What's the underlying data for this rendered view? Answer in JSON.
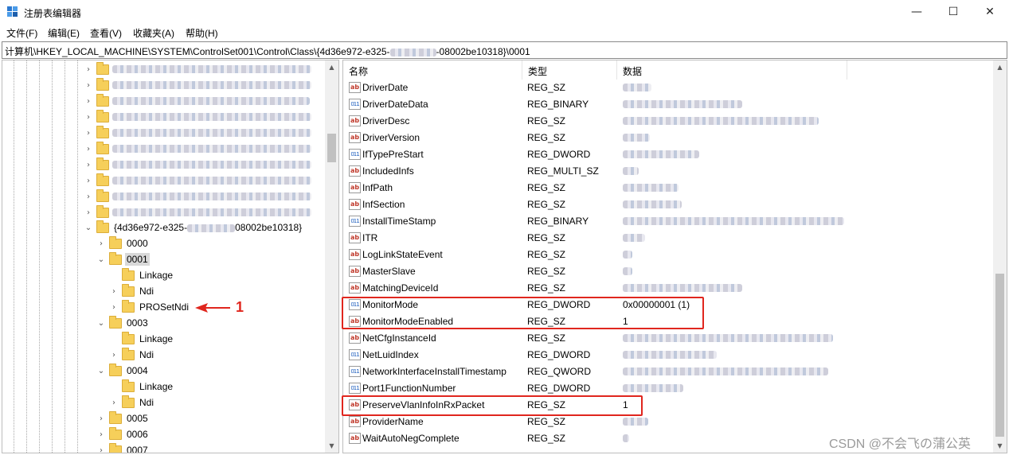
{
  "window": {
    "title": "注册表编辑器",
    "minimize_glyph": "—",
    "maximize_glyph": "☐",
    "close_glyph": "✕"
  },
  "menu": [
    "文件(F)",
    "编辑(E)",
    "查看(V)",
    "收藏夹(A)",
    "帮助(H)"
  ],
  "address": {
    "path_prefix": "计算机\\HKEY_LOCAL_MACHINE\\SYSTEM\\ControlSet001\\Control\\Class\\{4d36e972-e325-",
    "path_suffix": "-08002be10318}\\0001"
  },
  "tree": {
    "parent_key_prefix": "{4d36e972-e325-",
    "parent_key_suffix": "08002be10318}",
    "children": [
      {
        "label": "0000",
        "expanded": false
      },
      {
        "label": "0001",
        "expanded": true,
        "selected": true,
        "children": [
          "Linkage",
          "Ndi",
          "PROSetNdi"
        ]
      },
      {
        "label": "0003",
        "expanded": true,
        "children": [
          "Linkage",
          "Ndi"
        ]
      },
      {
        "label": "0004",
        "expanded": true,
        "children": [
          "Linkage",
          "Ndi"
        ]
      },
      {
        "label": "0005",
        "expanded": false
      },
      {
        "label": "0006",
        "expanded": false
      },
      {
        "label": "0007",
        "expanded": false
      }
    ]
  },
  "annotation": {
    "number": "1",
    "color": "#e0261e"
  },
  "columns": {
    "name": "名称",
    "type": "类型",
    "data": "数据"
  },
  "values": [
    {
      "name": "DriverDate",
      "icon": "string-value-icon",
      "type": "REG_SZ",
      "data": ""
    },
    {
      "name": "DriverDateData",
      "icon": "binary-value-icon",
      "type": "REG_BINARY",
      "data": ""
    },
    {
      "name": "DriverDesc",
      "icon": "string-value-icon",
      "type": "REG_SZ",
      "data": ""
    },
    {
      "name": "DriverVersion",
      "icon": "string-value-icon",
      "type": "REG_SZ",
      "data": ""
    },
    {
      "name": "IfTypePreStart",
      "icon": "binary-value-icon",
      "type": "REG_DWORD",
      "data": ""
    },
    {
      "name": "IncludedInfs",
      "icon": "string-value-icon",
      "type": "REG_MULTI_SZ",
      "data": ""
    },
    {
      "name": "InfPath",
      "icon": "string-value-icon",
      "type": "REG_SZ",
      "data": ""
    },
    {
      "name": "InfSection",
      "icon": "string-value-icon",
      "type": "REG_SZ",
      "data": ""
    },
    {
      "name": "InstallTimeStamp",
      "icon": "binary-value-icon",
      "type": "REG_BINARY",
      "data": ""
    },
    {
      "name": "ITR",
      "icon": "string-value-icon",
      "type": "REG_SZ",
      "data": ""
    },
    {
      "name": "LogLinkStateEvent",
      "icon": "string-value-icon",
      "type": "REG_SZ",
      "data": ""
    },
    {
      "name": "MasterSlave",
      "icon": "string-value-icon",
      "type": "REG_SZ",
      "data": ""
    },
    {
      "name": "MatchingDeviceId",
      "icon": "string-value-icon",
      "type": "REG_SZ",
      "data": ""
    },
    {
      "name": "MonitorMode",
      "icon": "binary-value-icon",
      "type": "REG_DWORD",
      "data": "0x00000001 (1)"
    },
    {
      "name": "MonitorModeEnabled",
      "icon": "string-value-icon",
      "type": "REG_SZ",
      "data": "1"
    },
    {
      "name": "NetCfgInstanceId",
      "icon": "string-value-icon",
      "type": "REG_SZ",
      "data": ""
    },
    {
      "name": "NetLuidIndex",
      "icon": "binary-value-icon",
      "type": "REG_DWORD",
      "data": ""
    },
    {
      "name": "NetworkInterfaceInstallTimestamp",
      "icon": "binary-value-icon",
      "type": "REG_QWORD",
      "data": ""
    },
    {
      "name": "Port1FunctionNumber",
      "icon": "binary-value-icon",
      "type": "REG_DWORD",
      "data": ""
    },
    {
      "name": "PreserveVlanInfoInRxPacket",
      "icon": "string-value-icon",
      "type": "REG_SZ",
      "data": "1"
    },
    {
      "name": "ProviderName",
      "icon": "string-value-icon",
      "type": "REG_SZ",
      "data": ""
    },
    {
      "name": "WaitAutoNegComplete",
      "icon": "string-value-icon",
      "type": "REG_SZ",
      "data": ""
    }
  ],
  "watermark": "CSDN @不会飞の蒲公英"
}
